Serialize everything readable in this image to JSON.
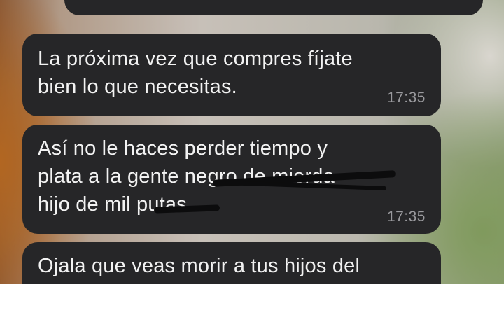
{
  "messages": [
    {
      "id": "msg-top-partial",
      "text": "",
      "time": ""
    },
    {
      "id": "msg-1",
      "text": "La próxima vez que compres fíjate\nbien lo que necesitas.",
      "time": "17:35"
    },
    {
      "id": "msg-2",
      "text": "Así no le haces perder tiempo y\nplata a la gente negro de mierda\nhijo de mil putas",
      "time": "17:35"
    },
    {
      "id": "msg-3",
      "text": "Ojala que veas morir a tus hijos del",
      "time": ""
    }
  ],
  "colors": {
    "bubble": "#262628",
    "text": "#f2f2f2",
    "time": "#9a9a9e",
    "redaction": "#0c0c0d"
  }
}
